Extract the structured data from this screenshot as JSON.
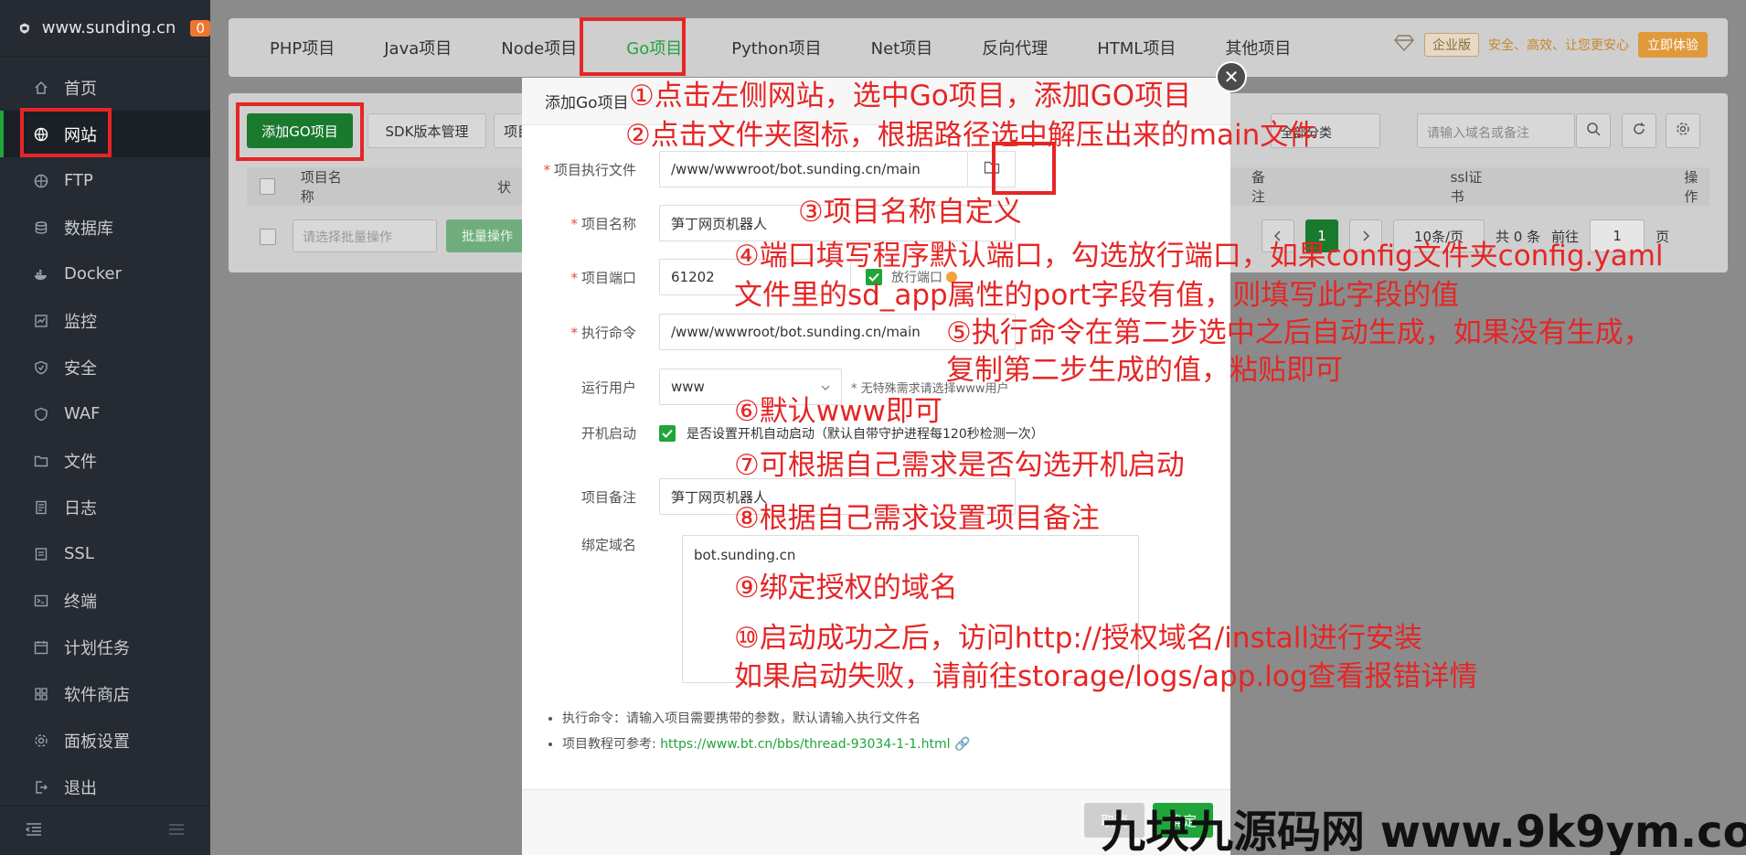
{
  "sidebar": {
    "site": "www.sunding.cn",
    "badge": "0",
    "items": [
      {
        "label": "首页",
        "icon": "home-icon"
      },
      {
        "label": "网站",
        "icon": "globe-icon"
      },
      {
        "label": "FTP",
        "icon": "ftp-icon"
      },
      {
        "label": "数据库",
        "icon": "database-icon"
      },
      {
        "label": "Docker",
        "icon": "docker-icon"
      },
      {
        "label": "监控",
        "icon": "monitor-icon"
      },
      {
        "label": "安全",
        "icon": "shield-icon"
      },
      {
        "label": "WAF",
        "icon": "waf-icon"
      },
      {
        "label": "文件",
        "icon": "folder-icon"
      },
      {
        "label": "日志",
        "icon": "log-icon"
      },
      {
        "label": "SSL",
        "icon": "ssl-icon"
      },
      {
        "label": "终端",
        "icon": "terminal-icon"
      },
      {
        "label": "计划任务",
        "icon": "calendar-icon"
      },
      {
        "label": "软件商店",
        "icon": "store-icon"
      },
      {
        "label": "面板设置",
        "icon": "gear-icon"
      },
      {
        "label": "退出",
        "icon": "logout-icon"
      }
    ]
  },
  "tabs": [
    "PHP项目",
    "Java项目",
    "Node项目",
    "Go项目",
    "Python项目",
    "Net项目",
    "反向代理",
    "HTML项目",
    "其他项目"
  ],
  "promo": {
    "edition": "企业版",
    "text": "安全、高效、让您更安心",
    "button": "立即体验"
  },
  "toolbar": {
    "add_go": "添加GO项目",
    "sdk": "SDK版本管理",
    "cut_text": "项目",
    "category": "全部分类",
    "search_placeholder": "请输入域名或备注"
  },
  "table": {
    "col_name": "项目名称",
    "col_status_cut": "状",
    "col_note": "备注",
    "col_ssl": "ssl证书",
    "col_ops": "操作"
  },
  "batch": {
    "select": "请选择批量操作",
    "button": "批量操作"
  },
  "pager": {
    "current": "1",
    "per_page": "10条/页",
    "total": "共 0 条",
    "goto_label": "前往",
    "goto_value": "1",
    "page_unit": "页"
  },
  "modal": {
    "title": "添加Go项目",
    "exec_file_label": "项目执行文件",
    "exec_file_value": "/www/wwwroot/bot.sunding.cn/main",
    "name_label": "项目名称",
    "name_value": "笋丁网页机器人",
    "port_label": "项目端口",
    "port_value": "61202",
    "open_port": "放行端口",
    "cmd_label": "执行命令",
    "cmd_value": "/www/wwwroot/bot.sunding.cn/main",
    "user_label": "运行用户",
    "user_value": "www",
    "user_hint": "* 无特殊需求请选择www用户",
    "boot_label": "开机启动",
    "boot_hint": "是否设置开机自动启动（默认自带守护进程每120秒检测一次）",
    "remark_label": "项目备注",
    "remark_value": "笋丁网页机器人",
    "domain_label": "绑定域名",
    "domain_value": "bot.sunding.cn",
    "note1": "执行命令：请输入项目需要携带的参数，默认请输入执行文件名",
    "note2_prefix": "项目教程可参考: ",
    "note2_link": "https://www.bt.cn/bbs/thread-93034-1-1.html",
    "cancel": "取消",
    "confirm": "确定"
  },
  "annotations": [
    "①点击左侧网站，选中Go项目，添加GO项目",
    "②点击文件夹图标，根据路径选中解压出来的main文件",
    "③项目名称自定义",
    "④端口填写程序默认端口，勾选放行端口，如果config文件夹config.yaml",
    "文件里的sd_app属性的port字段有值，则填写此字段的值",
    "⑤执行命令在第二步选中之后自动生成，如果没有生成，",
    "复制第二步生成的值，粘贴即可",
    "⑥默认www即可",
    "⑦可根据自己需求是否勾选开机启动",
    "⑧根据自己需求设置项目备注",
    "⑨绑定授权的域名",
    "⑩启动成功之后，访问http://授权域名/install进行安装",
    "如果启动失败，请前往storage/logs/app.log查看报错详情"
  ],
  "watermark": "九块九源码网 www.9k9ym.com",
  "colors": {
    "green": "#20a53a",
    "red": "#e52626",
    "sidebar": "#252a33"
  }
}
